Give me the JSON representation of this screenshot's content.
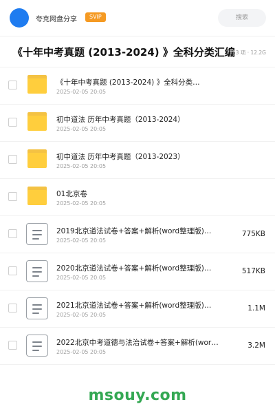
{
  "header": {
    "brand": "夸克网盘分享",
    "badge": "SVIP",
    "search_placeholder": "搜索"
  },
  "title": {
    "text": "《十年中考真题 (2013-2024) 》全科分类汇编",
    "meta": "7553 项 · 12.2G"
  },
  "items": [
    {
      "type": "folder",
      "name": "《十年中考真题 (2013-2024) 》全科分类…",
      "date": "2025-02-05 20:05",
      "size": ""
    },
    {
      "type": "folder",
      "name": "初中道法 历年中考真题（2013-2024）",
      "date": "2025-02-05 20:05",
      "size": ""
    },
    {
      "type": "folder",
      "name": "初中道法 历年中考真题（2013-2023）",
      "date": "2025-02-05 20:05",
      "size": ""
    },
    {
      "type": "folder",
      "name": "01北京卷",
      "date": "2025-02-05 20:05",
      "size": ""
    },
    {
      "type": "doc",
      "name": "2019北京道法试卷+答案+解析(word整理版)…",
      "date": "2025-02-05 20:05",
      "size": "775KB"
    },
    {
      "type": "doc",
      "name": "2020北京道法试卷+答案+解析(word整理版)…",
      "date": "2025-02-05 20:05",
      "size": "517KB"
    },
    {
      "type": "doc",
      "name": "2021北京道法试卷+答案+解析(word整理版)…",
      "date": "2025-02-05 20:05",
      "size": "1.1M"
    },
    {
      "type": "doc",
      "name": "2022北京中考道德与法治试卷+答案+解析(wor…",
      "date": "2025-02-05 20:05",
      "size": "3.2M"
    }
  ],
  "footer": {
    "watermark": "msouy.com"
  },
  "colors": {
    "avatar": "#1f7cf0",
    "badge": "#f59a23",
    "folder": "#ffce3d",
    "watermark": "#34a853"
  }
}
